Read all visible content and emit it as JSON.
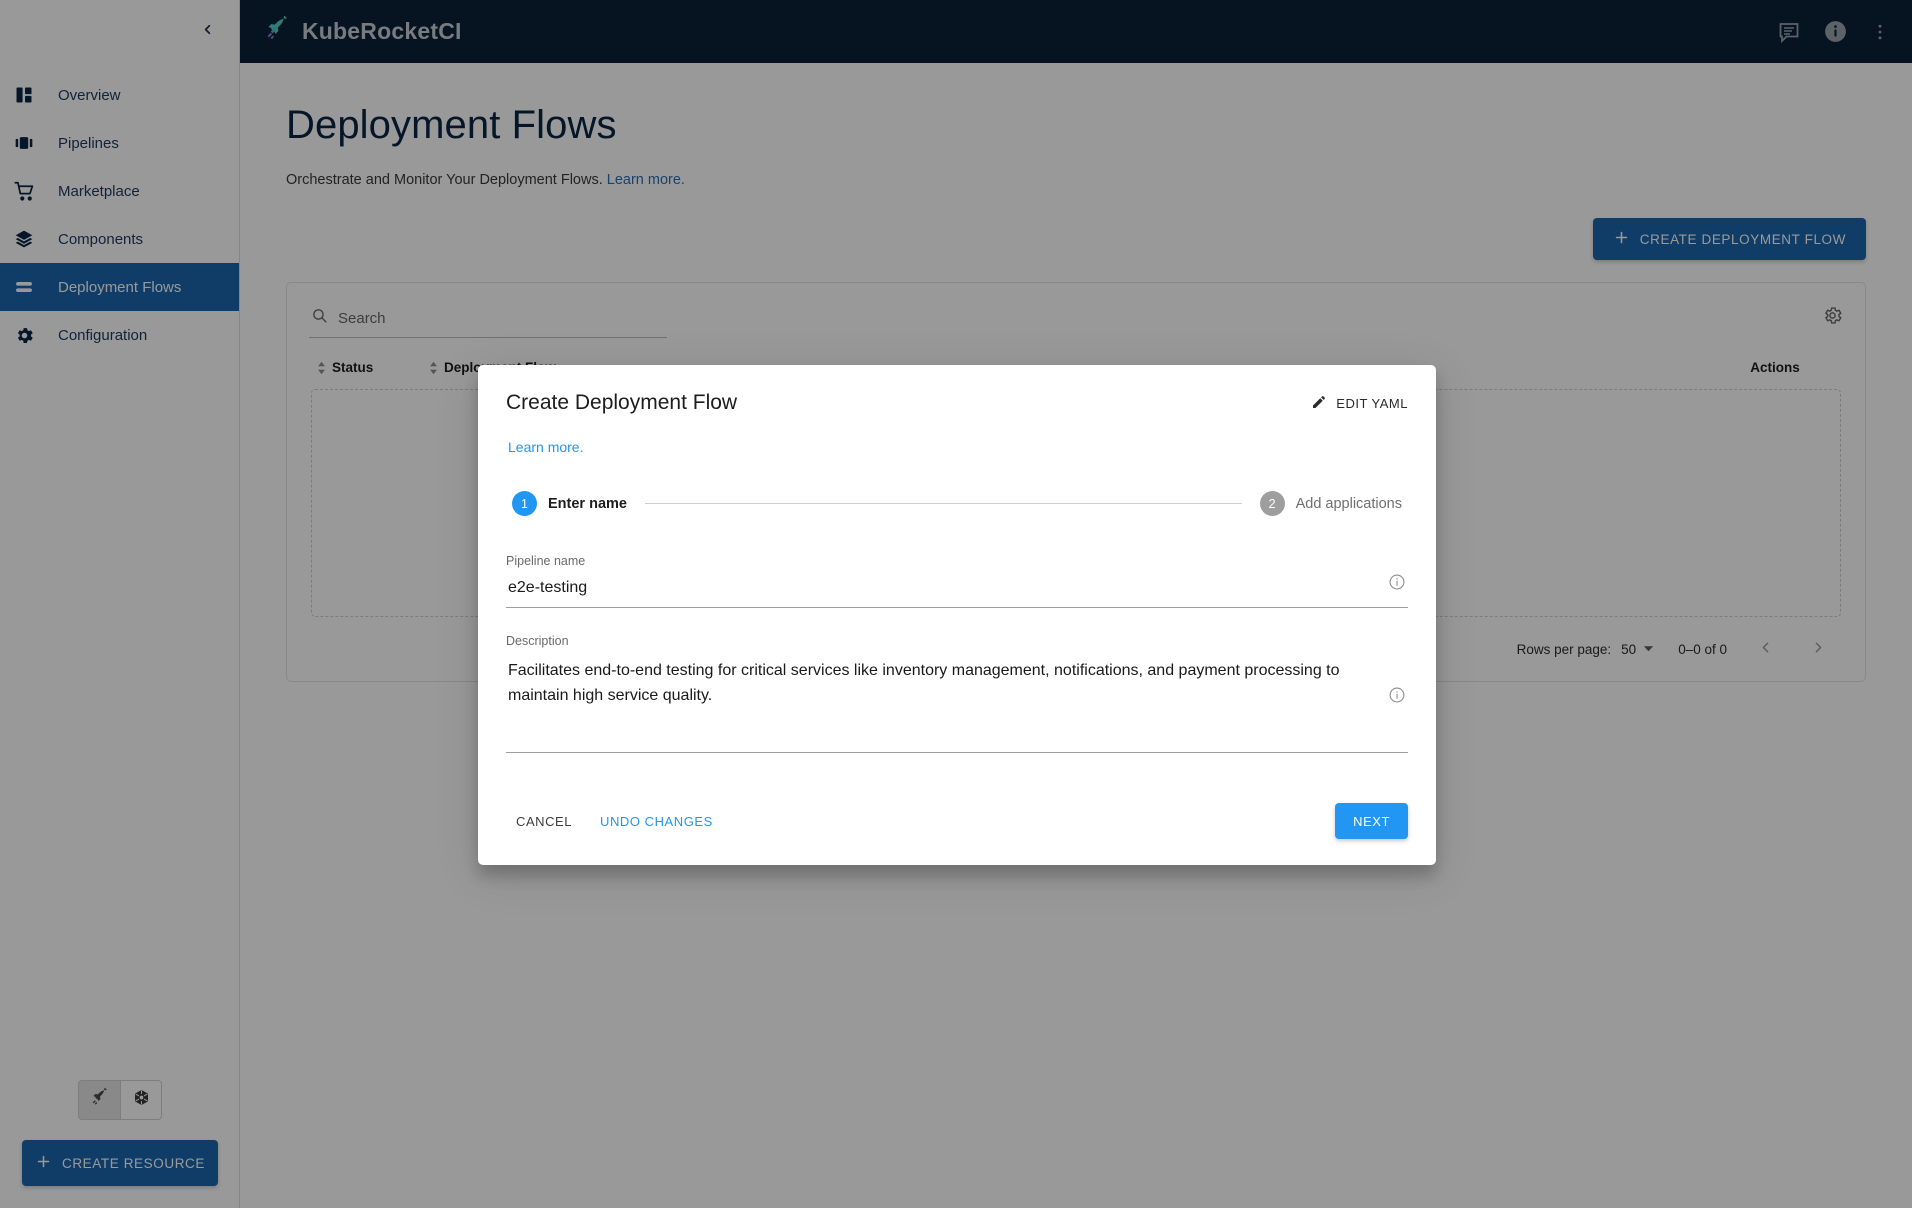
{
  "header": {
    "brand": "KubeRocketCI",
    "logo_icon": "rocket-icon",
    "icons": [
      {
        "name": "chat-icon",
        "label": "Feedback"
      },
      {
        "name": "info-icon",
        "label": "Info"
      },
      {
        "name": "kebab-menu-icon",
        "label": "More"
      }
    ]
  },
  "sidebar": {
    "collapse_icon": "chevron-left-icon",
    "items": [
      {
        "label": "Overview",
        "icon": "dashboard-icon",
        "active": false
      },
      {
        "label": "Pipelines",
        "icon": "pipelines-icon",
        "active": false
      },
      {
        "label": "Marketplace",
        "icon": "cart-icon",
        "active": false
      },
      {
        "label": "Components",
        "icon": "layers-icon",
        "active": false
      },
      {
        "label": "Deployment Flows",
        "icon": "flows-icon",
        "active": true
      },
      {
        "label": "Configuration",
        "icon": "gear-icon",
        "active": false
      }
    ],
    "toggles": [
      {
        "name": "rocket-toggle",
        "icon": "rocket-icon",
        "selected": true
      },
      {
        "name": "kubernetes-toggle",
        "icon": "kubernetes-icon",
        "selected": false
      }
    ],
    "create_resource_label": "CREATE RESOURCE"
  },
  "page": {
    "title": "Deployment Flows",
    "subtitle": "Orchestrate and Monitor Your Deployment Flows.",
    "subtitle_link": "Learn more.",
    "create_button": "CREATE DEPLOYMENT FLOW"
  },
  "panel": {
    "search_placeholder": "Search",
    "search_value": "",
    "search_icon": "search-icon",
    "settings_icon": "gear-icon",
    "columns": [
      "Status",
      "Deployment Flow",
      "Actions"
    ],
    "rows": [],
    "pagination": {
      "rows_per_page_label": "Rows per page:",
      "rows_per_page_value": "50",
      "range": "0–0 of 0",
      "prev_icon": "chevron-left-icon",
      "next_icon": "chevron-right-icon"
    }
  },
  "modal": {
    "title": "Create Deployment Flow",
    "edit_yaml_label": "EDIT YAML",
    "edit_yaml_icon": "pencil-icon",
    "learn_more": "Learn more.",
    "steps": [
      {
        "number": "1",
        "label": "Enter name",
        "active": true
      },
      {
        "number": "2",
        "label": "Add applications",
        "active": false
      }
    ],
    "fields": {
      "pipeline_name": {
        "label": "Pipeline name",
        "value": "e2e-testing",
        "info_icon": "info-icon"
      },
      "description": {
        "label": "Description",
        "value": "Facilitates end-to-end testing for critical services like inventory management, notifications, and payment processing to maintain high service quality.",
        "info_icon": "info-icon"
      }
    },
    "buttons": {
      "cancel": "CANCEL",
      "undo": "UNDO CHANGES",
      "next": "NEXT"
    }
  },
  "colors": {
    "brand_dark": "#0b2038",
    "primary": "#1b67ac",
    "accent": "#2196f3",
    "title": "#0b2545"
  }
}
